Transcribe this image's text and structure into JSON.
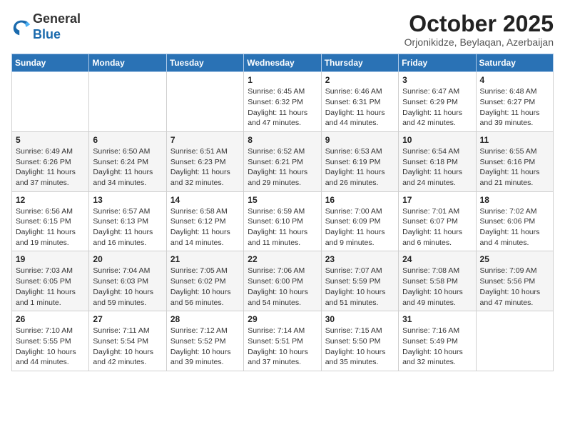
{
  "header": {
    "logo_line1": "General",
    "logo_line2": "Blue",
    "month_title": "October 2025",
    "subtitle": "Orjonikidze, Beylaqan, Azerbaijan"
  },
  "weekdays": [
    "Sunday",
    "Monday",
    "Tuesday",
    "Wednesday",
    "Thursday",
    "Friday",
    "Saturday"
  ],
  "weeks": [
    [
      {
        "day": "",
        "info": ""
      },
      {
        "day": "",
        "info": ""
      },
      {
        "day": "",
        "info": ""
      },
      {
        "day": "1",
        "info": "Sunrise: 6:45 AM\nSunset: 6:32 PM\nDaylight: 11 hours\nand 47 minutes."
      },
      {
        "day": "2",
        "info": "Sunrise: 6:46 AM\nSunset: 6:31 PM\nDaylight: 11 hours\nand 44 minutes."
      },
      {
        "day": "3",
        "info": "Sunrise: 6:47 AM\nSunset: 6:29 PM\nDaylight: 11 hours\nand 42 minutes."
      },
      {
        "day": "4",
        "info": "Sunrise: 6:48 AM\nSunset: 6:27 PM\nDaylight: 11 hours\nand 39 minutes."
      }
    ],
    [
      {
        "day": "5",
        "info": "Sunrise: 6:49 AM\nSunset: 6:26 PM\nDaylight: 11 hours\nand 37 minutes."
      },
      {
        "day": "6",
        "info": "Sunrise: 6:50 AM\nSunset: 6:24 PM\nDaylight: 11 hours\nand 34 minutes."
      },
      {
        "day": "7",
        "info": "Sunrise: 6:51 AM\nSunset: 6:23 PM\nDaylight: 11 hours\nand 32 minutes."
      },
      {
        "day": "8",
        "info": "Sunrise: 6:52 AM\nSunset: 6:21 PM\nDaylight: 11 hours\nand 29 minutes."
      },
      {
        "day": "9",
        "info": "Sunrise: 6:53 AM\nSunset: 6:19 PM\nDaylight: 11 hours\nand 26 minutes."
      },
      {
        "day": "10",
        "info": "Sunrise: 6:54 AM\nSunset: 6:18 PM\nDaylight: 11 hours\nand 24 minutes."
      },
      {
        "day": "11",
        "info": "Sunrise: 6:55 AM\nSunset: 6:16 PM\nDaylight: 11 hours\nand 21 minutes."
      }
    ],
    [
      {
        "day": "12",
        "info": "Sunrise: 6:56 AM\nSunset: 6:15 PM\nDaylight: 11 hours\nand 19 minutes."
      },
      {
        "day": "13",
        "info": "Sunrise: 6:57 AM\nSunset: 6:13 PM\nDaylight: 11 hours\nand 16 minutes."
      },
      {
        "day": "14",
        "info": "Sunrise: 6:58 AM\nSunset: 6:12 PM\nDaylight: 11 hours\nand 14 minutes."
      },
      {
        "day": "15",
        "info": "Sunrise: 6:59 AM\nSunset: 6:10 PM\nDaylight: 11 hours\nand 11 minutes."
      },
      {
        "day": "16",
        "info": "Sunrise: 7:00 AM\nSunset: 6:09 PM\nDaylight: 11 hours\nand 9 minutes."
      },
      {
        "day": "17",
        "info": "Sunrise: 7:01 AM\nSunset: 6:07 PM\nDaylight: 11 hours\nand 6 minutes."
      },
      {
        "day": "18",
        "info": "Sunrise: 7:02 AM\nSunset: 6:06 PM\nDaylight: 11 hours\nand 4 minutes."
      }
    ],
    [
      {
        "day": "19",
        "info": "Sunrise: 7:03 AM\nSunset: 6:05 PM\nDaylight: 11 hours\nand 1 minute."
      },
      {
        "day": "20",
        "info": "Sunrise: 7:04 AM\nSunset: 6:03 PM\nDaylight: 10 hours\nand 59 minutes."
      },
      {
        "day": "21",
        "info": "Sunrise: 7:05 AM\nSunset: 6:02 PM\nDaylight: 10 hours\nand 56 minutes."
      },
      {
        "day": "22",
        "info": "Sunrise: 7:06 AM\nSunset: 6:00 PM\nDaylight: 10 hours\nand 54 minutes."
      },
      {
        "day": "23",
        "info": "Sunrise: 7:07 AM\nSunset: 5:59 PM\nDaylight: 10 hours\nand 51 minutes."
      },
      {
        "day": "24",
        "info": "Sunrise: 7:08 AM\nSunset: 5:58 PM\nDaylight: 10 hours\nand 49 minutes."
      },
      {
        "day": "25",
        "info": "Sunrise: 7:09 AM\nSunset: 5:56 PM\nDaylight: 10 hours\nand 47 minutes."
      }
    ],
    [
      {
        "day": "26",
        "info": "Sunrise: 7:10 AM\nSunset: 5:55 PM\nDaylight: 10 hours\nand 44 minutes."
      },
      {
        "day": "27",
        "info": "Sunrise: 7:11 AM\nSunset: 5:54 PM\nDaylight: 10 hours\nand 42 minutes."
      },
      {
        "day": "28",
        "info": "Sunrise: 7:12 AM\nSunset: 5:52 PM\nDaylight: 10 hours\nand 39 minutes."
      },
      {
        "day": "29",
        "info": "Sunrise: 7:14 AM\nSunset: 5:51 PM\nDaylight: 10 hours\nand 37 minutes."
      },
      {
        "day": "30",
        "info": "Sunrise: 7:15 AM\nSunset: 5:50 PM\nDaylight: 10 hours\nand 35 minutes."
      },
      {
        "day": "31",
        "info": "Sunrise: 7:16 AM\nSunset: 5:49 PM\nDaylight: 10 hours\nand 32 minutes."
      },
      {
        "day": "",
        "info": ""
      }
    ]
  ]
}
